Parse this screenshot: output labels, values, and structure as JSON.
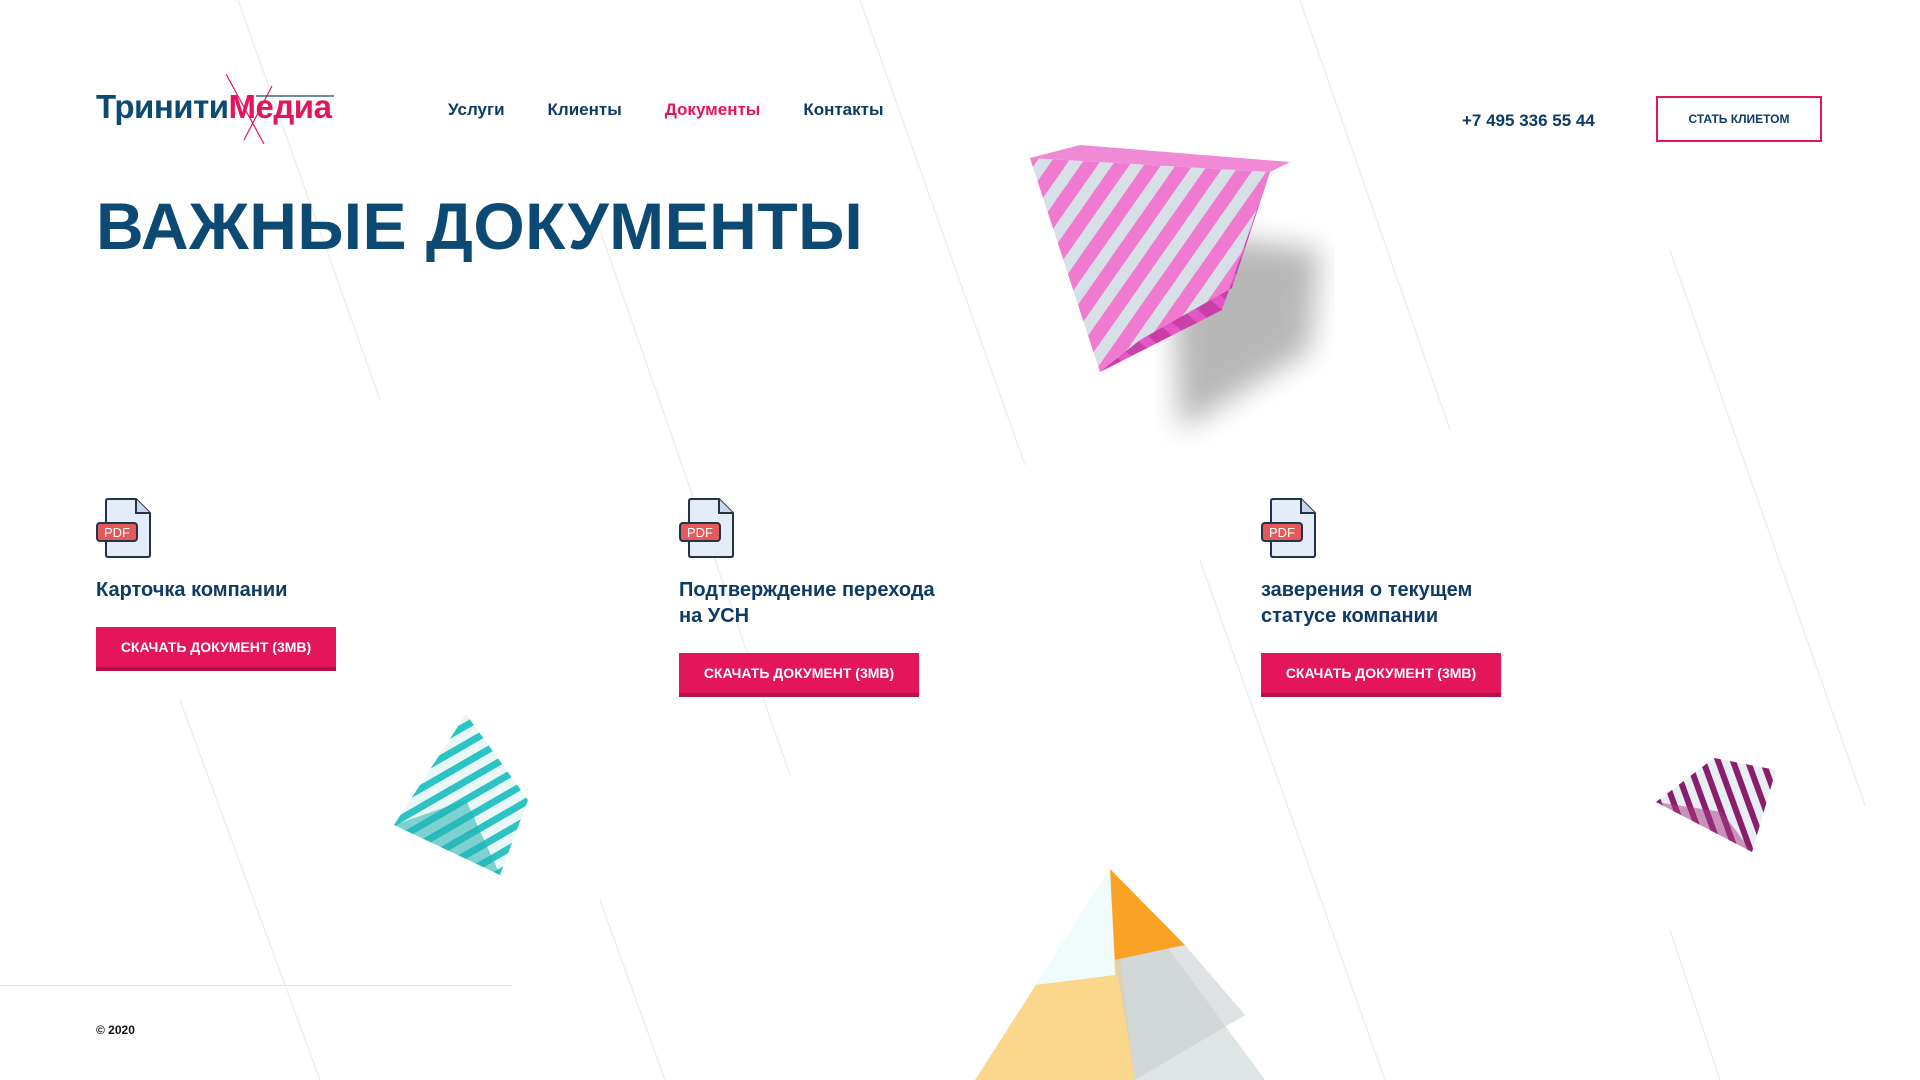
{
  "brand": {
    "logo_part1": "Тринити",
    "logo_part2": "Медиа",
    "primary_color": "#0d4a73",
    "accent_color": "#e3165b"
  },
  "nav": {
    "items": [
      {
        "label": "Услуги",
        "active": false
      },
      {
        "label": "Клиенты",
        "active": false
      },
      {
        "label": "Документы",
        "active": true
      },
      {
        "label": "Контакты",
        "active": false
      }
    ]
  },
  "header": {
    "phone": "+7 495 336 55 44",
    "cta_label": "СТАТЬ КЛИЕТОМ"
  },
  "page": {
    "title": "ВАЖНЫЕ ДОКУМЕНТЫ"
  },
  "documents": [
    {
      "icon": "pdf-file-icon",
      "icon_text": "PDF",
      "name": "Карточка компании",
      "button_label": "СКАЧАТЬ ДОКУМЕНТ (3MB)"
    },
    {
      "icon": "pdf-file-icon",
      "icon_text": "PDF",
      "name": "Подтверждение перехода на УСН",
      "button_label": "СКАЧАТЬ ДОКУМЕНТ (3MB)"
    },
    {
      "icon": "pdf-file-icon",
      "icon_text": "PDF",
      "name": "заверения о текущем статусе компании",
      "button_label": "СКАЧАТЬ ДОКУМЕНТ (3MB)"
    }
  ],
  "footer": {
    "copyright": "© 2020"
  }
}
